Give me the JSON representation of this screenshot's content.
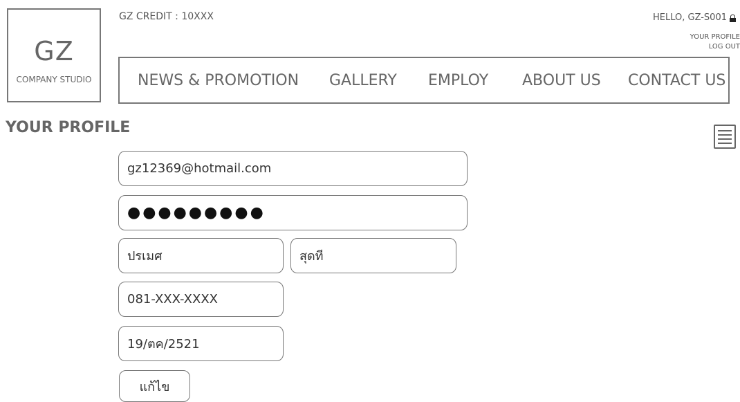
{
  "logo": {
    "big": "GZ",
    "small": "COMPANY STUDIO"
  },
  "header": {
    "credit": "GZ CREDIT : 10XXX",
    "hello": "HELLO, GZ-S001",
    "your_profile_link": "YOUR PROFILE",
    "logout_link": "LOG OUT"
  },
  "nav": {
    "items": [
      "NEWS & PROMOTION",
      "GALLERY",
      "EMPLOY",
      "ABOUT US",
      "CONTACT US"
    ]
  },
  "page": {
    "title": "YOUR PROFILE"
  },
  "form": {
    "email": "gz12369@hotmail.com",
    "password": "●●●●●●●●●",
    "first_name": "ปรเมศ",
    "last_name": "สุดที",
    "phone": "081-XXX-XXXX",
    "birthdate": "19/ตค/2521",
    "edit_button": "แก้ไข"
  },
  "icons": {
    "menu": "hamburger-menu-icon",
    "lock": "lock-icon"
  }
}
